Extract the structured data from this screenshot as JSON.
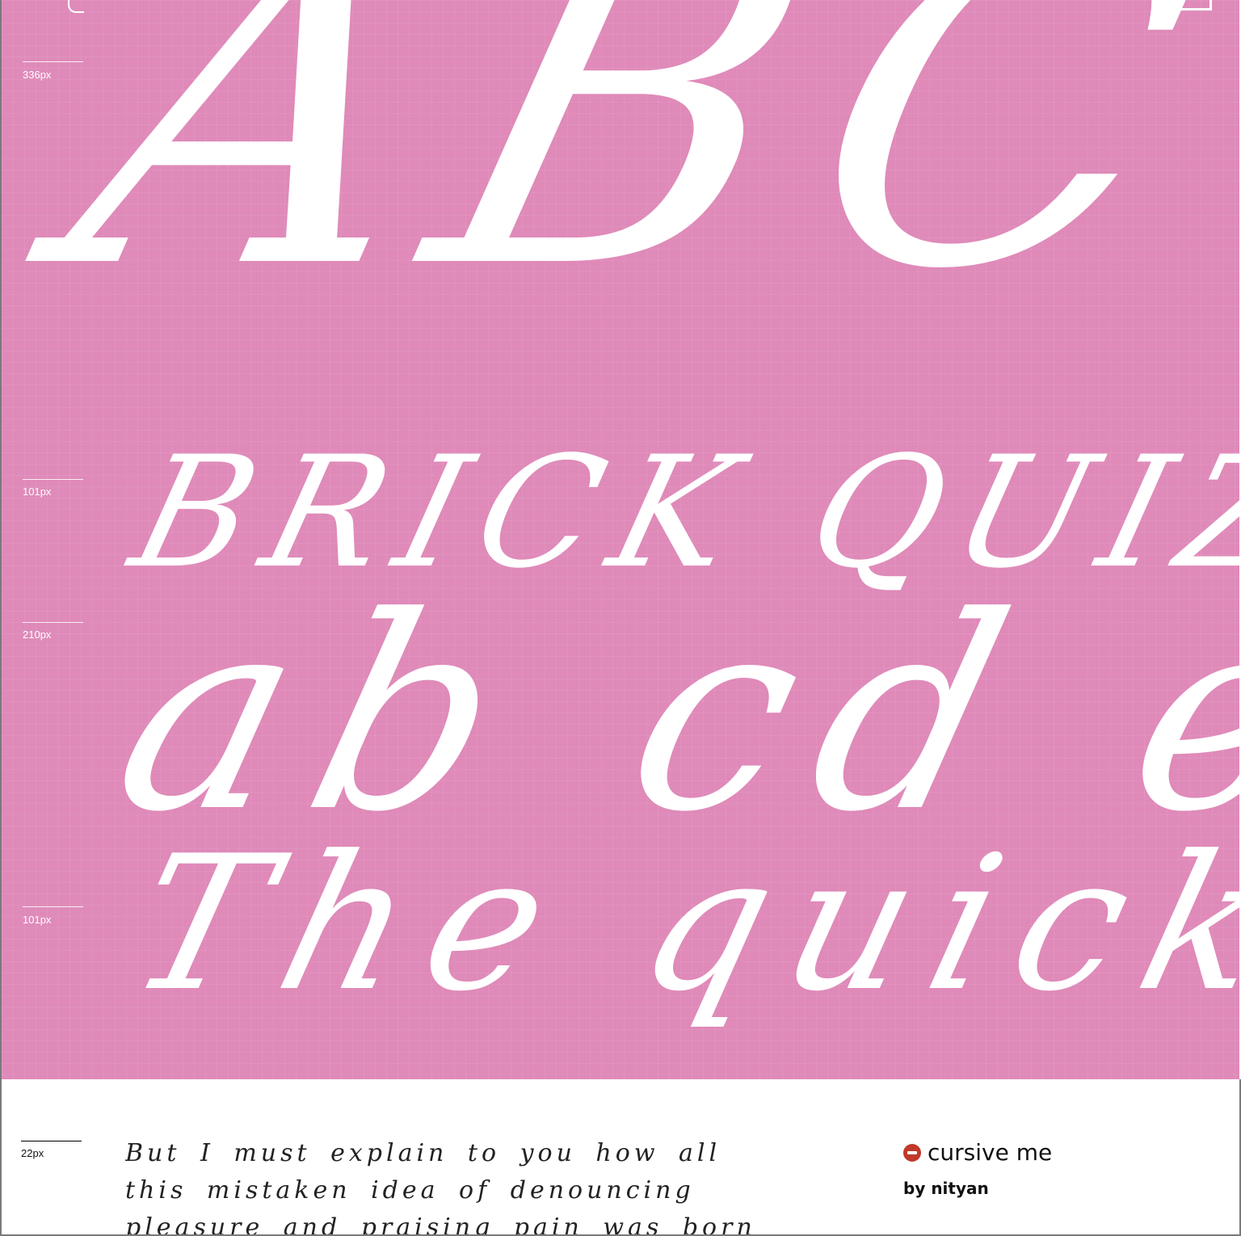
{
  "specimen": {
    "background_color": "#df8ab9",
    "glyph_color": "#ffffff",
    "lines": {
      "abc": "ABC",
      "brick": "BRICK QUIZ",
      "lower": "ab cd ef",
      "quick": "The quick br"
    },
    "rulers": [
      "336px",
      "101px",
      "210px",
      "101px"
    ]
  },
  "sample": {
    "size_label": "22px",
    "paragraph": "But I must explain to you how all this mistaken idea of denouncing pleasure and praising pain was born and I will"
  },
  "font": {
    "name": "cursive me",
    "author": "by nityan",
    "status_icon": "minus-circle-icon",
    "status_color": "#c0392b"
  }
}
